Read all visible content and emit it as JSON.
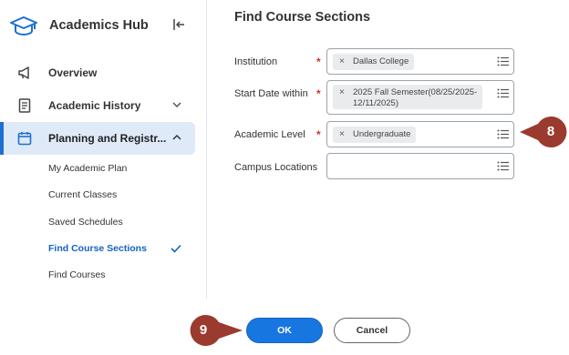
{
  "sidebar": {
    "title": "Academics Hub",
    "nav": [
      {
        "label": "Overview",
        "icon": "megaphone-icon"
      },
      {
        "label": "Academic History",
        "icon": "document-icon"
      },
      {
        "label": "Planning and Registr...",
        "icon": "calendar-icon"
      }
    ],
    "sub_items": [
      {
        "label": "My Academic Plan"
      },
      {
        "label": "Current Classes"
      },
      {
        "label": "Saved Schedules"
      },
      {
        "label": "Find Course Sections"
      },
      {
        "label": "Find Courses"
      }
    ]
  },
  "main": {
    "title": "Find Course Sections",
    "fields": [
      {
        "label": "Institution",
        "required": true,
        "value": "Dallas College"
      },
      {
        "label": "Start Date within",
        "required": true,
        "value_line1": "2025 Fall Semester(08/25/2025-",
        "value_line2": "12/11/2025)"
      },
      {
        "label": "Academic Level",
        "required": true,
        "value": "Undergraduate"
      },
      {
        "label": "Campus Locations",
        "required": false,
        "value": ""
      }
    ],
    "required_marker": "*",
    "remove_glyph": "×"
  },
  "callouts": {
    "first": "8",
    "second": "9"
  },
  "buttons": {
    "ok": "OK",
    "cancel": "Cancel"
  },
  "colors": {
    "accent": "#1876e0",
    "active_nav_bg": "#dfeaf8",
    "required": "#c8372d",
    "callout": "#9b3a2e"
  }
}
